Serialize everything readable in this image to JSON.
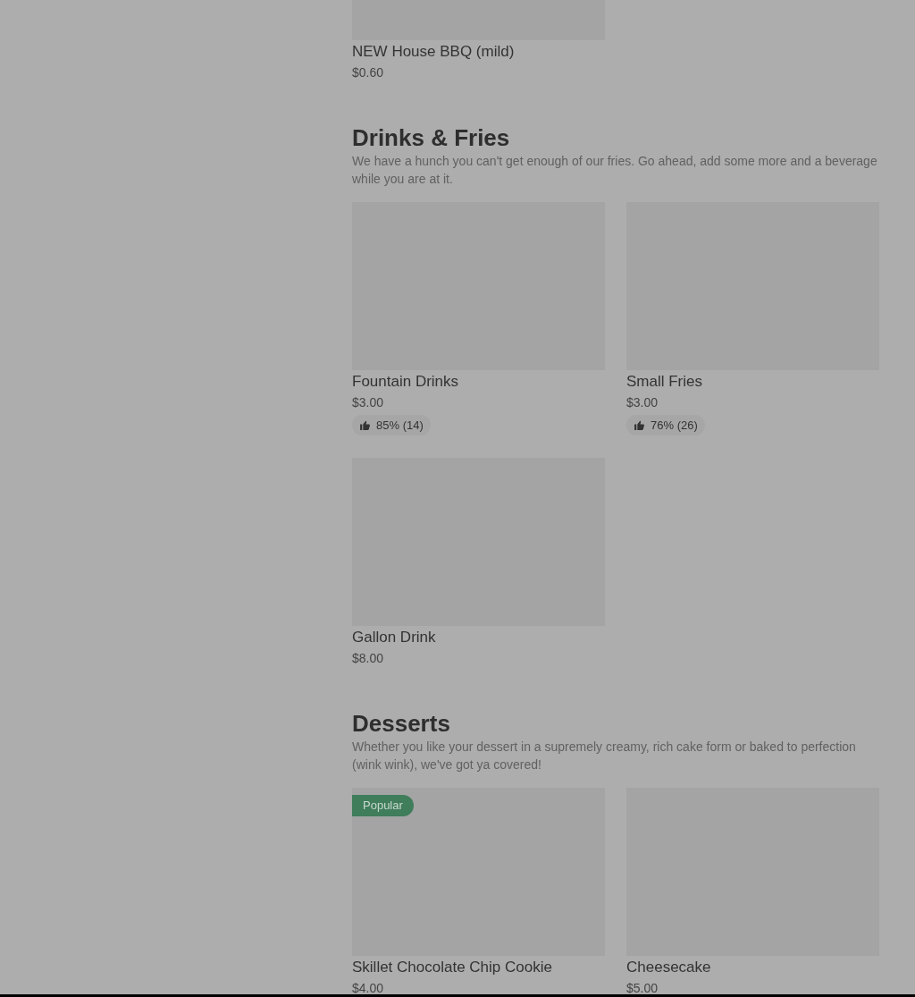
{
  "sections": [
    {
      "items": [
        {
          "name": "NEW House BBQ (mild)",
          "price": "$0.60",
          "kind": "partial"
        }
      ]
    },
    {
      "title": "Drinks & Fries",
      "description": "We have a hunch you can't get enough of our fries. Go ahead, add some more and a beverage while you are at it.",
      "items": [
        {
          "name": "Fountain Drinks",
          "price": "$3.00",
          "rating": "85% (14)"
        },
        {
          "name": "Small Fries",
          "price": "$3.00",
          "rating": "76% (26)"
        },
        {
          "name": "Gallon Drink",
          "price": "$8.00"
        }
      ]
    },
    {
      "title": "Desserts",
      "description": "Whether you like your dessert in a supremely creamy, rich cake form or baked to perfection (wink wink), we've got ya covered!",
      "items": [
        {
          "name": "Skillet Chocolate Chip Cookie",
          "price": "$4.00",
          "badge": "Popular"
        },
        {
          "name": "Cheesecake",
          "price": "$5.00"
        }
      ]
    }
  ]
}
